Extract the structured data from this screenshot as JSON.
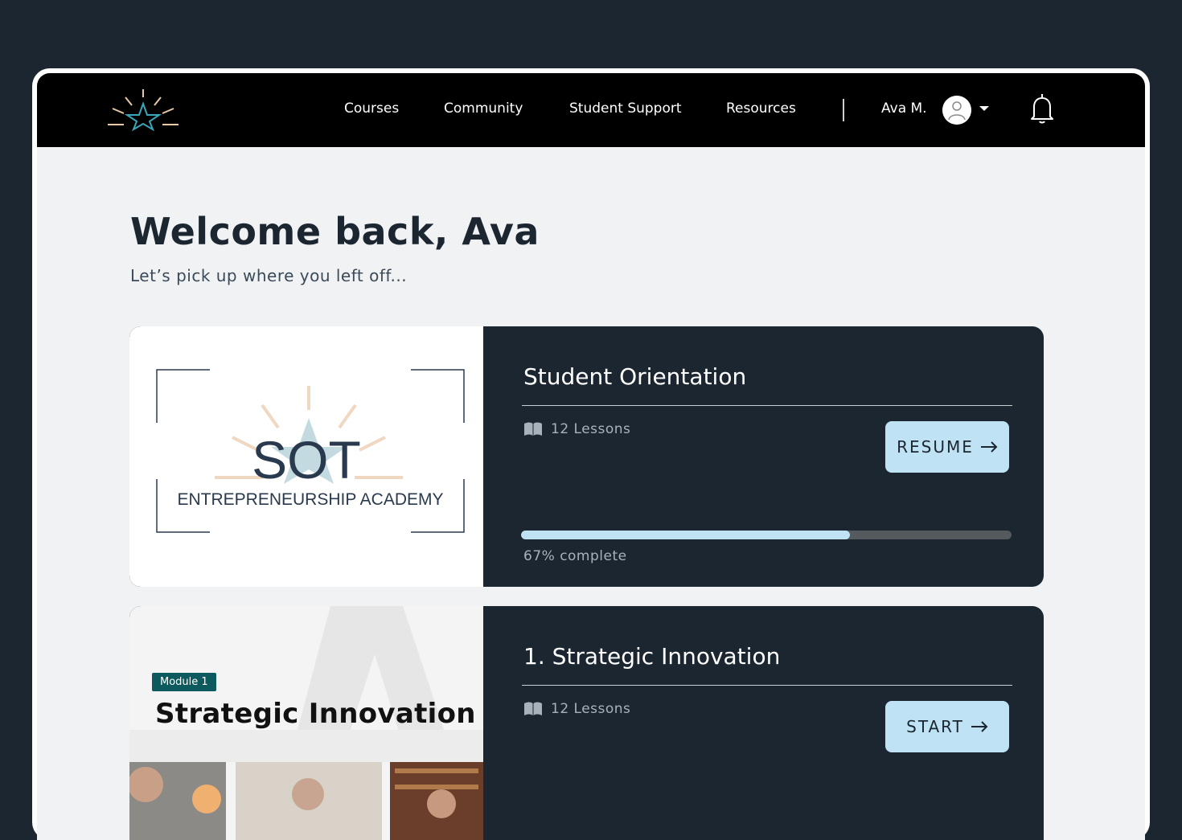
{
  "nav": {
    "items": [
      "Courses",
      "Community",
      "Student Support",
      "Resources"
    ],
    "user_name": "Ava M."
  },
  "welcome": {
    "title": "Welcome back, Ava",
    "subtitle": "Let’s pick up where you left off..."
  },
  "courses": [
    {
      "title": "Student Orientation",
      "lessons": "12 Lessons",
      "cta": "RESUME",
      "progress": 67,
      "progress_text": "67% complete",
      "thumb": {
        "logo_text": "SOT",
        "caption": "ENTREPRENEURSHIP ACADEMY"
      }
    },
    {
      "title": "1. Strategic Innovation",
      "lessons": "12 Lessons",
      "cta": "START",
      "thumb": {
        "badge": "Module 1",
        "title": "Strategic Innovation"
      }
    }
  ],
  "colors": {
    "background": "#1b2630",
    "accent": "#bfe3f4",
    "card": "#1b2630",
    "badge": "#0c5a5e"
  },
  "icons": [
    "logo-star-icon",
    "avatar-icon",
    "caret-down-icon",
    "bell-icon",
    "book-icon",
    "arrow-right-icon"
  ]
}
